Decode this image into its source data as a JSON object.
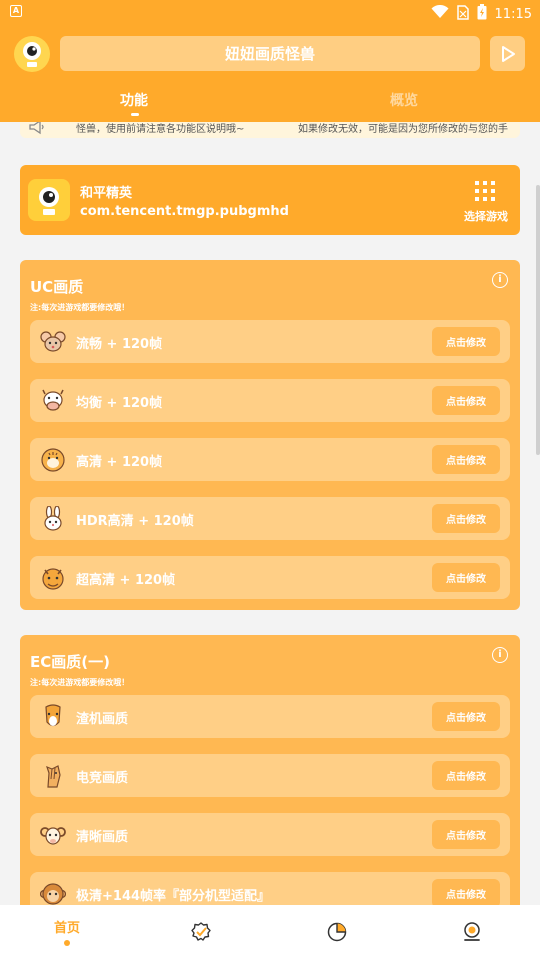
{
  "status_bar": {
    "left_icon": "A",
    "time": "11:15",
    "icons": [
      "wifi-icon",
      "no-sim-icon",
      "battery-charging-icon"
    ]
  },
  "header": {
    "title": "妞妞画质怪兽",
    "tabs": [
      {
        "label": "功能",
        "active": true
      },
      {
        "label": "概览",
        "active": false
      }
    ]
  },
  "marquee": {
    "text_1": "怪兽，使用前请注意各功能区说明哦~",
    "text_2": "如果修改无效，可能是因为您所修改的与您的手"
  },
  "game": {
    "name": "和平精英",
    "package": "com.tencent.tmgp.pubgmhd",
    "select_label": "选择游戏"
  },
  "sections": [
    {
      "title": "UC画质",
      "note": "注:每次进游戏都要修改哦！",
      "items": [
        {
          "label": "流畅 + 120帧",
          "button": "点击修改",
          "icon": "mouse-icon"
        },
        {
          "label": "均衡 + 120帧",
          "button": "点击修改",
          "icon": "cow-icon"
        },
        {
          "label": "高清 + 120帧",
          "button": "点击修改",
          "icon": "tiger-icon"
        },
        {
          "label": "HDR高清 + 120帧",
          "button": "点击修改",
          "icon": "rabbit-icon"
        },
        {
          "label": "超高清 + 120帧",
          "button": "点击修改",
          "icon": "dragon-icon"
        }
      ]
    },
    {
      "title": "EC画质(一)",
      "note": "注:每次进游戏都要修改哦！",
      "items": [
        {
          "label": "渣机画质",
          "button": "点击修改",
          "icon": "snake-icon"
        },
        {
          "label": "电竞画质",
          "button": "点击修改",
          "icon": "horse-icon"
        },
        {
          "label": "清晰画质",
          "button": "点击修改",
          "icon": "goat-icon"
        },
        {
          "label": "极清+144帧率『部分机型适配』",
          "button": "点击修改",
          "icon": "monkey-icon"
        }
      ]
    }
  ],
  "bottom_nav": [
    {
      "label": "首页",
      "active": true,
      "icon": "home-icon"
    },
    {
      "label": "",
      "active": false,
      "icon": "badge-check-icon"
    },
    {
      "label": "",
      "active": false,
      "icon": "pie-chart-icon"
    },
    {
      "label": "",
      "active": false,
      "icon": "profile-icon"
    }
  ],
  "colors": {
    "accent": "#ffaa2b",
    "section_bg": "#ffb852",
    "row_bg": "#ffcf86",
    "page_bg": "#f3f3f3"
  }
}
